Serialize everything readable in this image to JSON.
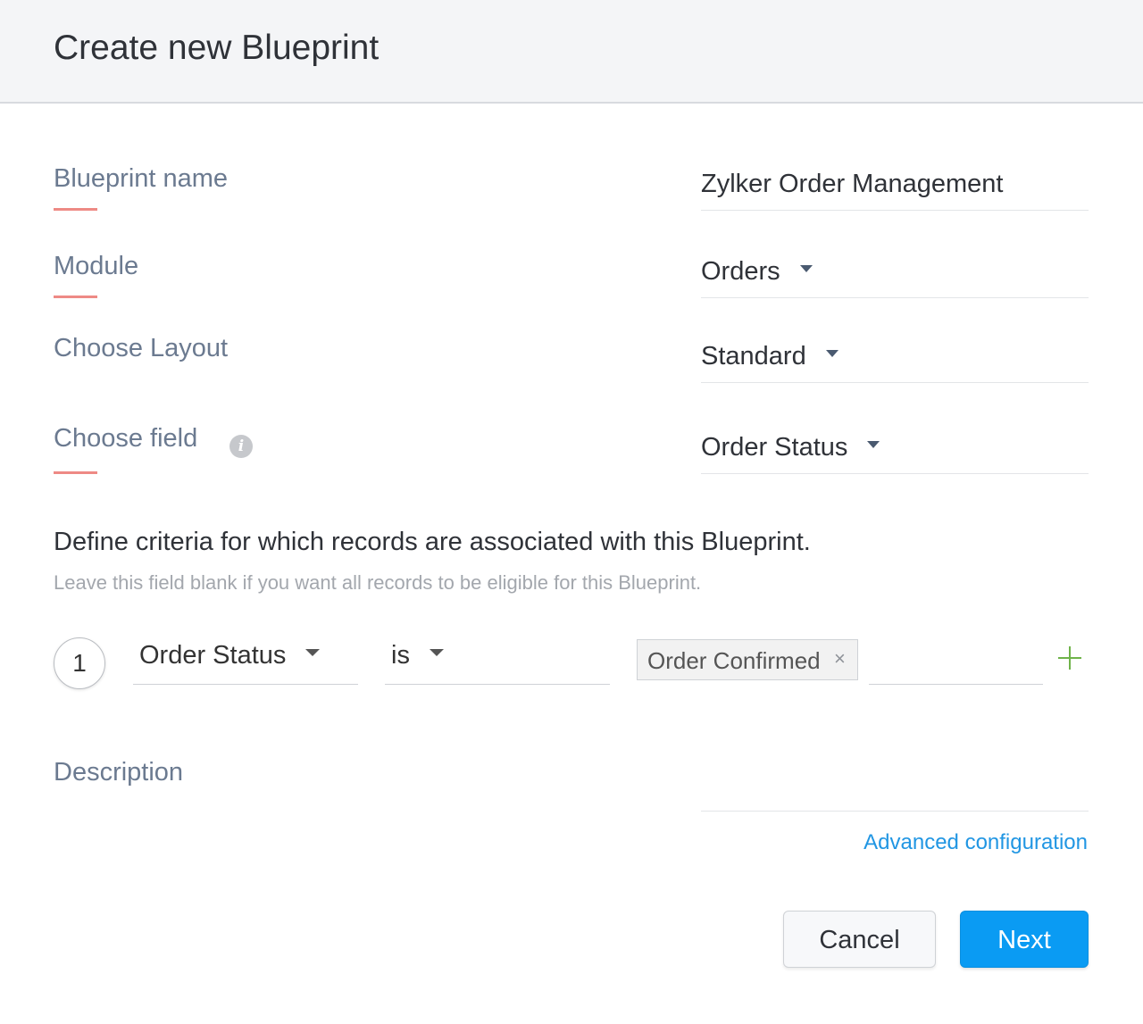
{
  "header": {
    "title": "Create new Blueprint"
  },
  "form": {
    "blueprint_name": {
      "label": "Blueprint name",
      "value": "Zylker Order Management"
    },
    "module": {
      "label": "Module",
      "value": "Orders"
    },
    "layout": {
      "label": "Choose Layout",
      "value": "Standard"
    },
    "field": {
      "label": "Choose field",
      "value": "Order Status",
      "info_icon": "info-icon"
    }
  },
  "criteria": {
    "title": "Define criteria for which records are associated with this Blueprint.",
    "hint": "Leave this field blank if you want all records to be eligible for this Blueprint.",
    "rows": [
      {
        "index": "1",
        "field": "Order Status",
        "operator": "is",
        "values": [
          "Order Confirmed"
        ],
        "remove_glyph": "×"
      }
    ]
  },
  "description": {
    "label": "Description",
    "value": ""
  },
  "advanced_link": "Advanced configuration",
  "buttons": {
    "cancel": "Cancel",
    "next": "Next"
  },
  "colors": {
    "accent": "#0a9bf3",
    "link": "#2196e3",
    "mandatory": "#ee8a85",
    "add": "#6fb34a"
  }
}
